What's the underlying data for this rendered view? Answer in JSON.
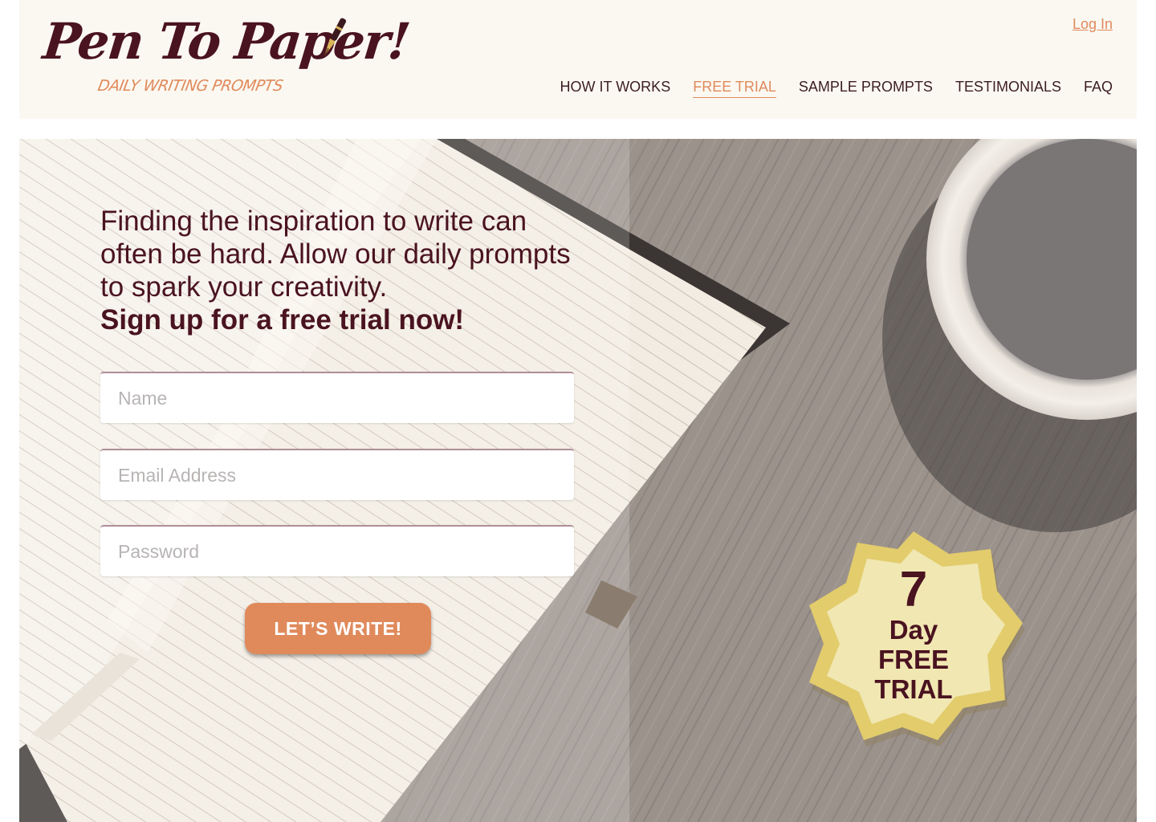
{
  "brand": {
    "name": "Pen To Paper!",
    "tagline": "DAILY WRITING PROMPTS",
    "logo_icon": "fountain-pen-icon"
  },
  "header": {
    "login_label": "Log In",
    "nav": [
      {
        "label": "HOW IT WORKS",
        "active": false
      },
      {
        "label": "FREE TRIAL",
        "active": true
      },
      {
        "label": "SAMPLE PROMPTS",
        "active": false
      },
      {
        "label": "TESTIMONIALS",
        "active": false
      },
      {
        "label": "FAQ",
        "active": false
      }
    ]
  },
  "hero": {
    "intro": "Finding the inspiration to write can often be hard. Allow our daily prompts to spark your creativity.",
    "cta_text": "Sign up for a free trial now!",
    "form": {
      "name_placeholder": "Name",
      "email_placeholder": "Email Address",
      "password_placeholder": "Password",
      "submit_label": "LET’S WRITE!"
    },
    "badge": {
      "number": "7",
      "line1": "Day",
      "line2": "FREE",
      "line3": "TRIAL"
    }
  },
  "colors": {
    "brand_maroon": "#4a1320",
    "accent_orange": "#e08a5c",
    "header_bg": "#fbf8f1",
    "badge_gold": "#e2cc6c",
    "badge_cream": "#f1e7b2"
  }
}
